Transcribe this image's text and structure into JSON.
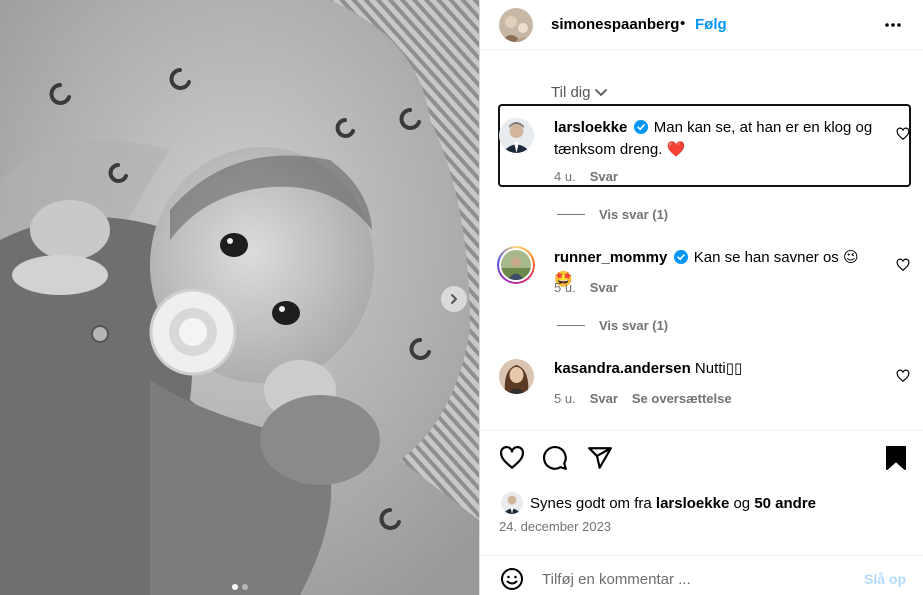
{
  "post": {
    "author": "simonespaanberg",
    "separator": "•",
    "follow_label": "Følg",
    "more_icon": "more-horizontal-icon",
    "carousel": {
      "slide_count": 2,
      "active_slide": 1
    }
  },
  "comments_sort": {
    "label": "Til dig",
    "icon": "chevron-down-icon"
  },
  "comments": [
    {
      "username": "larsloekke",
      "verified": true,
      "text": "Man kan se, at han er en klog og tænksom dreng.",
      "emoji": "❤️",
      "age": "4 u.",
      "reply_label": "Svar",
      "view_replies": "Vis svar (1)",
      "highlighted": true
    },
    {
      "username": "runner_mommy",
      "verified": true,
      "text": "Kan se han savner os",
      "emoji": "😉🤩",
      "age": "5 u.",
      "reply_label": "Svar",
      "view_replies": "Vis svar (1)"
    },
    {
      "username": "kasandra.andersen",
      "verified": false,
      "text": "Nutti▯▯",
      "age": "5 u.",
      "reply_label": "Svar",
      "translate_label": "Se oversættelse"
    }
  ],
  "actions": {
    "like_icon": "heart-icon",
    "comment_icon": "comment-icon",
    "share_icon": "send-icon",
    "save_icon": "bookmark-icon"
  },
  "likes": {
    "prefix": "Synes godt om fra",
    "user": "larsloekke",
    "joiner": "og",
    "others": "50 andre"
  },
  "date": "24. december 2023",
  "add_comment": {
    "placeholder": "Tilføj en kommentar ...",
    "post_label": "Slå op",
    "emoji_icon": "smiley-icon"
  },
  "colors": {
    "accent": "#0095f6",
    "muted": "#737373",
    "post_disabled": "#b3dbff",
    "verified": "#0095f6"
  }
}
